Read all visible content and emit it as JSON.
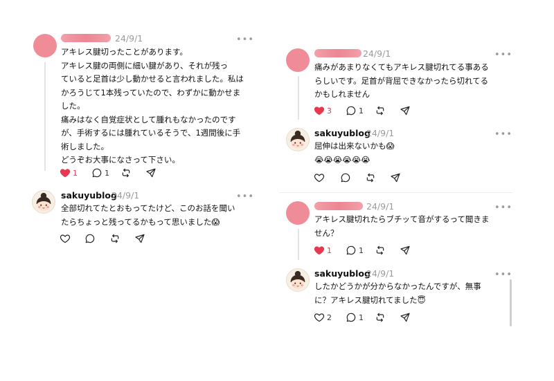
{
  "posts": {
    "p1": {
      "date": "24/9/1",
      "more": "•••",
      "text": "アキレス腱切ったことがあります。\nアキレス腱の両側に細い腱があり、それが残っ\nていると足首は少し動かせると言われました。私は\nかろうじて1本残っていたので、わずかに動かせま\nした。\n痛みはなく自覚症状として腫れもなかったのです\nが、手術するには腫れているそうで、1週間後に手\n術しました。\nどうぞお大事になさって下さい。",
      "likes": "1",
      "replies": "1"
    },
    "p2": {
      "username": "sakuyublog",
      "date": "24/9/1",
      "more": "•••",
      "text": "全部切れてたとおもってたけど、このお話を聞い\nたらちょっと残ってるかもって思いました😱"
    },
    "p3": {
      "date": "24/9/1",
      "more": "•••",
      "text": "痛みがあまりなくてもアキレス腱切れてる事ある\nらしいです。足首が背屈できなかったら切れてる\nかもしれません",
      "likes": "3",
      "replies": "1"
    },
    "p4": {
      "username": "sakuyublog",
      "date": "24/9/1",
      "more": "•••",
      "text": "屈伸は出来ないかも😱\n😭😭😭😭😭😭"
    },
    "p5": {
      "date": "24/9/1",
      "more": "•••",
      "text": "アキレス腱切れたらブチッて音がするって聞きま\nせん？",
      "likes": "1",
      "replies": "1"
    },
    "p6": {
      "username": "sakuyublog",
      "date": "24/9/1",
      "more": "•••",
      "text": "したかどうかが分からなかったんですが、無事\nに？アキレス腱切れてました😇",
      "likes": "2",
      "replies": "1"
    }
  },
  "icons": [
    "heart-icon",
    "comment-icon",
    "repost-icon",
    "share-icon",
    "more-icon"
  ],
  "colors": {
    "like_red": "#e8384f",
    "muted": "#9a9a9a",
    "redaction": "#f08c97"
  }
}
